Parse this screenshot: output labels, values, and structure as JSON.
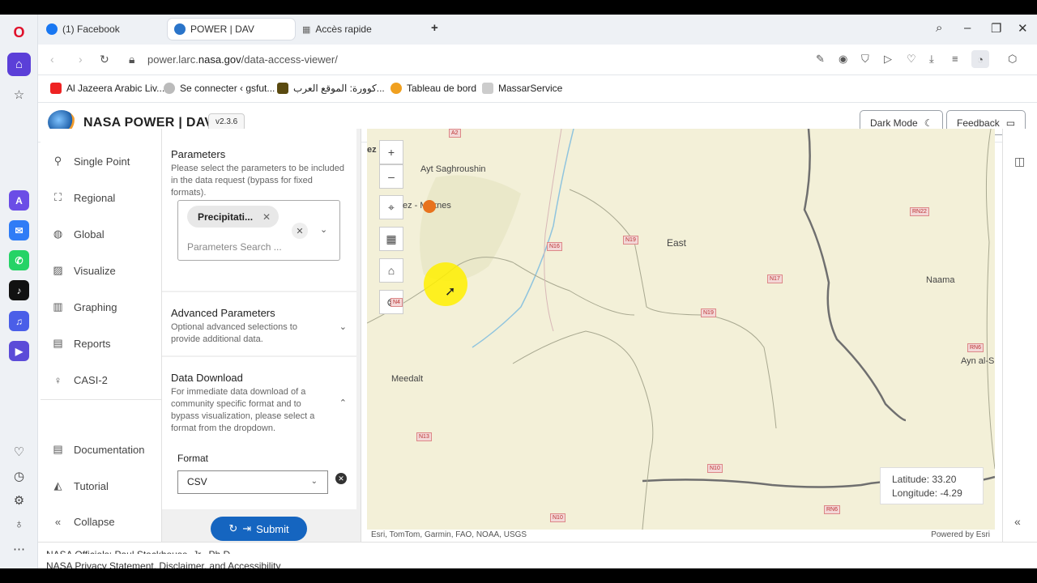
{
  "tabs": [
    {
      "label": "(1) Facebook"
    },
    {
      "label": "POWER | DAV"
    },
    {
      "label": "Accès rapide"
    }
  ],
  "address": {
    "url_prefix": "power.larc.",
    "url_domain": "nasa.gov",
    "url_path": "/data-access-viewer/"
  },
  "bookmarks": [
    {
      "label": "Al Jazeera Arabic Liv..."
    },
    {
      "label": "Se connecter ‹ gsfut..."
    },
    {
      "label": "كوورة: الموقع العرب..."
    },
    {
      "label": "Tableau de bord"
    },
    {
      "label": "MassarService"
    }
  ],
  "header": {
    "title": "NASA POWER | DAV",
    "version": "v2.3.6",
    "dark_mode": "Dark Mode",
    "feedback": "Feedback"
  },
  "nav": {
    "single_point": "Single Point",
    "regional": "Regional",
    "global": "Global",
    "visualize": "Visualize",
    "graphing": "Graphing",
    "reports": "Reports",
    "casi": "CASI-2",
    "documentation": "Documentation",
    "tutorial": "Tutorial",
    "collapse": "Collapse"
  },
  "parameters": {
    "title": "Parameters",
    "description": "Please select the parameters to be included in the data request (bypass for fixed formats).",
    "chip": "Precipitati...",
    "search_placeholder": "Parameters Search ..."
  },
  "advanced": {
    "title": "Advanced Parameters",
    "description": "Optional advanced selections to provide additional data."
  },
  "download": {
    "title": "Data Download",
    "description": "For immediate data download of a community specific format and to bypass visualization, please select a format from the dropdown.",
    "format_label": "Format",
    "format_value": "CSV",
    "submit": "Submit"
  },
  "map": {
    "places": {
      "ayt": "Ayt Saghroushin",
      "fez": "ez - Meknes",
      "east": "East",
      "naama": "Naama",
      "meedalt": "Meedalt",
      "ayn": "Ayn al-S",
      "edge": "ez"
    },
    "roads": {
      "a2": "A2",
      "n16": "N16",
      "n19a": "N19",
      "n17": "N17",
      "n19b": "N19",
      "rn22": "RN22",
      "n4": "N4",
      "rn6a": "RN6",
      "n13": "N13",
      "n10a": "N10",
      "rn6b": "RN6",
      "n10b": "N10"
    },
    "latitude": "Latitude: 33.20",
    "longitude": "Longitude: -4.29",
    "attribution": "Esri, TomTom, Garmin, FAO, NOAA, USGS",
    "powered": "Powered by Esri"
  },
  "footer": {
    "officials": "NASA Officials: Paul Stackhouse, Jr., Ph.D.",
    "privacy": "NASA Privacy Statement, Disclaimer, and Accessibility"
  }
}
